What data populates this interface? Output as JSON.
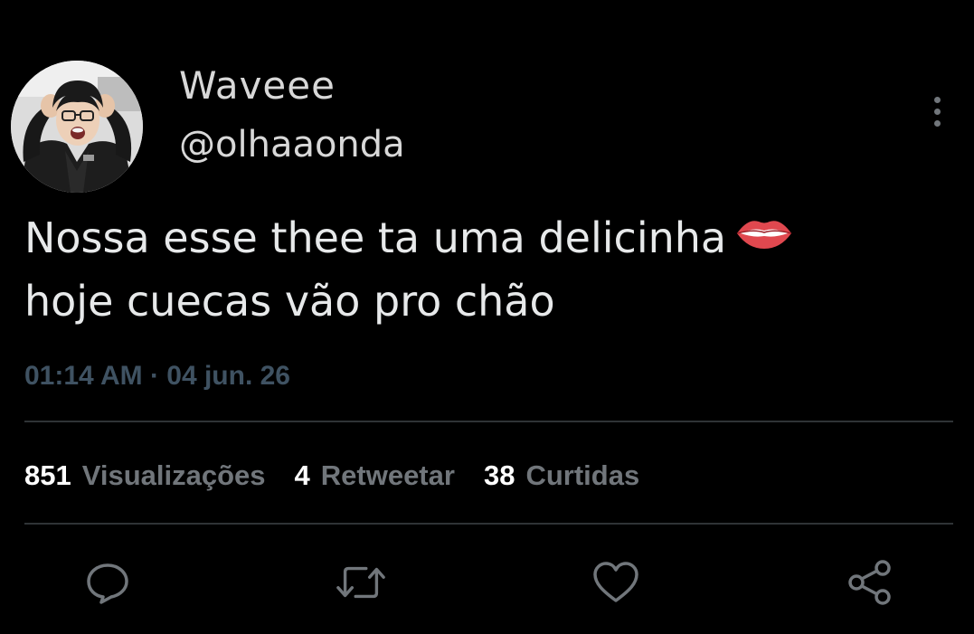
{
  "tweet": {
    "author": {
      "display_name": "Waveee",
      "handle": "@olhaaonda"
    },
    "text_lines": [
      "Nossa esse thee ta uma delicinha",
      "hoje cuecas vão pro chão"
    ],
    "emoji": "lips-emoji",
    "timestamp": "01:14 AM · 04 jun. 26",
    "stats": {
      "views_count": "851",
      "views_label": "Visualizações",
      "retweets_count": "4",
      "retweets_label": "Retweetar",
      "likes_count": "38",
      "likes_label": "Curtidas"
    },
    "actions": [
      "reply-icon",
      "retweet-icon",
      "like-icon",
      "share-icon"
    ]
  },
  "colors": {
    "background": "#000000",
    "primary_text": "#e7e9ea",
    "secondary_text": "#71767b",
    "timestamp": "#3f5262",
    "divider": "#2f3336"
  }
}
